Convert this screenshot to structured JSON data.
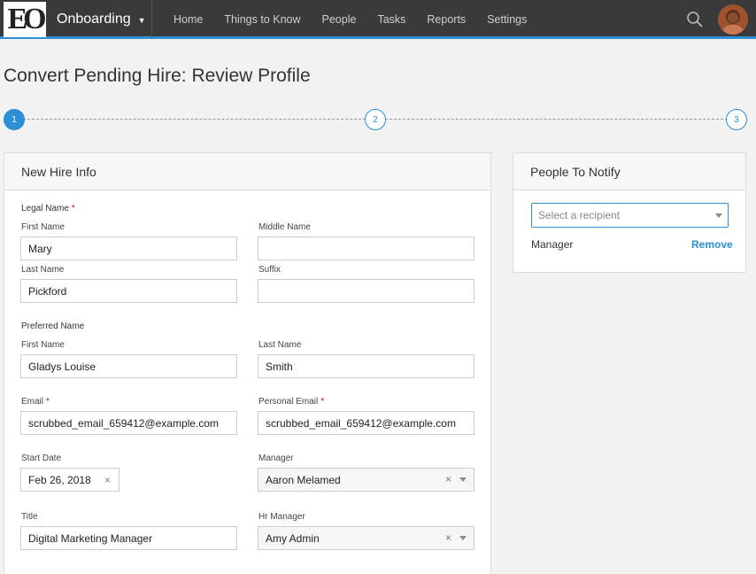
{
  "nav": {
    "logo_text": "EO",
    "app_name": "Onboarding",
    "items": [
      "Home",
      "Things to Know",
      "People",
      "Tasks",
      "Reports",
      "Settings"
    ]
  },
  "page": {
    "title": "Convert Pending Hire: Review Profile"
  },
  "stepper": {
    "steps": [
      "1",
      "2",
      "3"
    ],
    "active": 1
  },
  "new_hire": {
    "heading": "New Hire Info",
    "legal_name_label": "Legal Name",
    "first_name_label": "First Name",
    "first_name": "Mary",
    "middle_name_label": "Middle Name",
    "middle_name": "",
    "last_name_label": "Last Name",
    "last_name": "Pickford",
    "suffix_label": "Suffix",
    "suffix": "",
    "preferred_name_label": "Preferred Name",
    "pref_first_label": "First Name",
    "pref_first": "Gladys Louise",
    "pref_last_label": "Last Name",
    "pref_last": "Smith",
    "email_label": "Email",
    "email": "scrubbed_email_659412@example.com",
    "personal_email_label": "Personal Email",
    "personal_email": "scrubbed_email_659412@example.com",
    "start_date_label": "Start Date",
    "start_date": "Feb 26, 2018",
    "manager_label": "Manager",
    "manager": "Aaron Melamed",
    "title_label": "Title",
    "title": "Digital Marketing Manager",
    "hr_manager_label": "Hr Manager",
    "hr_manager": "Amy Admin",
    "required_mark": "*",
    "clear_glyph": "×"
  },
  "notify": {
    "heading": "People To Notify",
    "recipient_placeholder": "Select a recipient",
    "recipient_name": "Manager",
    "remove_label": "Remove"
  },
  "colors": {
    "accent": "#2d8fd5",
    "topbar": "#3a3a3a",
    "required": "#d0021b"
  }
}
